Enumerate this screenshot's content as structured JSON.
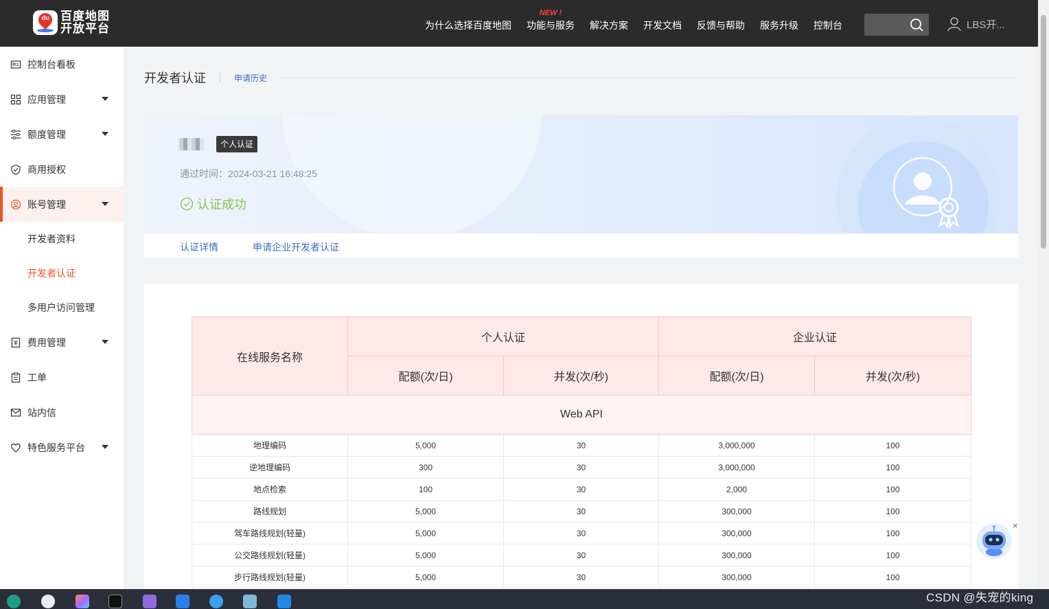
{
  "header": {
    "logo_text_line1": "百度地图",
    "logo_text_line2": "开放平台",
    "logo_badge_text": "du",
    "nav": [
      {
        "label": "为什么选择百度地图",
        "new": ""
      },
      {
        "label": "功能与服务",
        "new": "NEW !"
      },
      {
        "label": "解决方案",
        "new": ""
      },
      {
        "label": "开发文档",
        "new": ""
      },
      {
        "label": "反馈与帮助",
        "new": ""
      },
      {
        "label": "服务升级",
        "new": ""
      },
      {
        "label": "控制台",
        "new": ""
      }
    ],
    "search_value": "",
    "user_name": "LBS开..."
  },
  "sidebar": {
    "items": [
      {
        "label": "控制台看板",
        "icon": "dashboard-icon",
        "caret": false
      },
      {
        "label": "应用管理",
        "icon": "apps-grid-icon",
        "caret": true
      },
      {
        "label": "额度管理",
        "icon": "sliders-icon",
        "caret": true
      },
      {
        "label": "商用授权",
        "icon": "shield-check-icon",
        "caret": false
      },
      {
        "label": "账号管理",
        "icon": "user-circle-icon",
        "caret": true,
        "active": true
      },
      {
        "label": "费用管理",
        "icon": "bill-icon",
        "caret": true
      },
      {
        "label": "工单",
        "icon": "clipboard-icon",
        "caret": false
      },
      {
        "label": "站内信",
        "icon": "mail-icon",
        "caret": false
      },
      {
        "label": "特色服务平台",
        "icon": "heart-shield-icon",
        "caret": true
      }
    ],
    "account_sub": [
      "开发者资料",
      "开发者认证",
      "多用户访问管理"
    ]
  },
  "page": {
    "title": "开发者认证",
    "history_link": "申请历史"
  },
  "certification": {
    "badge": "个人认证",
    "pass_time": "通过时间：2024-03-21 16:48:25",
    "status": "认证成功",
    "tabs": [
      "认证详情",
      "申请企业开发者认证"
    ]
  },
  "quota_table": {
    "header_service": "在线服务名称",
    "header_personal": "个人认证",
    "header_enterprise": "企业认证",
    "header_quota": "配额(次/日)",
    "header_concurrency": "并发(次/秒)",
    "group": "Web API",
    "rows": [
      {
        "name": "地理编码",
        "p_quota": "5,000",
        "p_conc": "30",
        "e_quota": "3,000,000",
        "e_conc": "100"
      },
      {
        "name": "逆地理编码",
        "p_quota": "300",
        "p_conc": "30",
        "e_quota": "3,000,000",
        "e_conc": "100"
      },
      {
        "name": "地点检索",
        "p_quota": "100",
        "p_conc": "30",
        "e_quota": "2,000",
        "e_conc": "100"
      },
      {
        "name": "路线规划",
        "p_quota": "5,000",
        "p_conc": "30",
        "e_quota": "300,000",
        "e_conc": "100"
      },
      {
        "name": "驾车路线规划(轻量)",
        "p_quota": "5,000",
        "p_conc": "30",
        "e_quota": "300,000",
        "e_conc": "100"
      },
      {
        "name": "公交路线规划(轻量)",
        "p_quota": "5,000",
        "p_conc": "30",
        "e_quota": "300,000",
        "e_conc": "100"
      },
      {
        "name": "步行路线规划(轻量)",
        "p_quota": "5,000",
        "p_conc": "30",
        "e_quota": "300,000",
        "e_conc": "100"
      }
    ]
  },
  "widgets": {
    "robot_close": "×"
  },
  "watermark": "CSDN @失宠的king",
  "colors": {
    "accent": "#e8552b",
    "link": "#3d6cc4",
    "success": "#8cc34b",
    "topbar": "#2b2b2b"
  }
}
